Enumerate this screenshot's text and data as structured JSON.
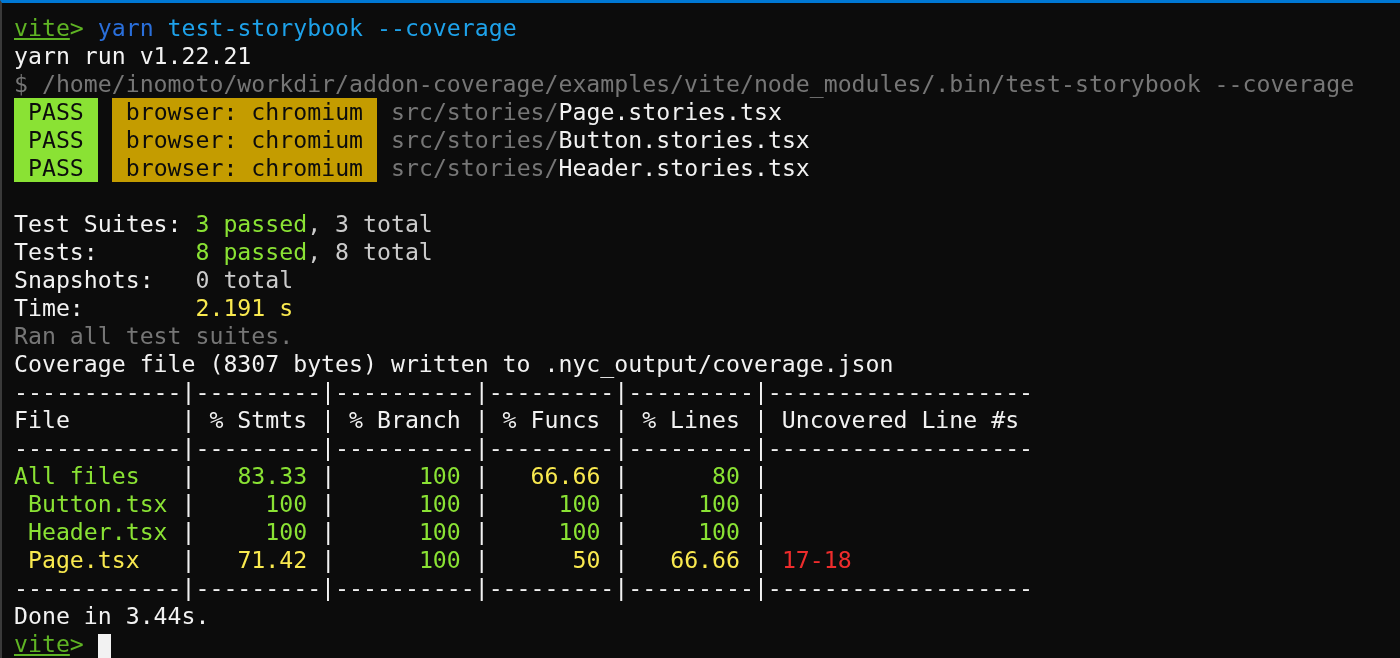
{
  "terminal": {
    "lines": [
      {
        "kind": "text",
        "segments": [
          {
            "text": "vite",
            "kind": "prompt_dir"
          },
          {
            "text": ">",
            "kind": "prompt_sign"
          },
          {
            "text": " yarn",
            "kind": "cmd_name"
          },
          {
            "text": " test-storybook --coverage",
            "kind": "cmd_arg"
          }
        ]
      },
      {
        "kind": "text",
        "segments": [
          {
            "text": "yarn run v1.22.21",
            "kind": "text"
          }
        ]
      },
      {
        "kind": "text",
        "segments": [
          {
            "text": "$ /home/inomoto/workdir/addon-coverage/examples/vite/node_modules/.bin/test-storybook --coverage",
            "kind": "muted"
          }
        ]
      },
      {
        "kind": "text",
        "segments": [
          {
            "text": " PASS ",
            "kind": "pass"
          },
          {
            "text": " browser: chromium ",
            "kind": "browser"
          },
          {
            "text": "src/stories/",
            "kind": "muted"
          },
          {
            "text": "Page.stories.tsx",
            "kind": "text"
          }
        ]
      },
      {
        "kind": "text",
        "segments": [
          {
            "text": " PASS ",
            "kind": "pass"
          },
          {
            "text": " browser: chromium ",
            "kind": "browser"
          },
          {
            "text": "src/stories/",
            "kind": "muted"
          },
          {
            "text": "Button.stories.tsx",
            "kind": "text"
          }
        ]
      },
      {
        "kind": "text",
        "segments": [
          {
            "text": " PASS ",
            "kind": "pass"
          },
          {
            "text": " browser: chromium ",
            "kind": "browser"
          },
          {
            "text": "src/stories/",
            "kind": "muted"
          },
          {
            "text": "Header.stories.tsx",
            "kind": "text"
          }
        ]
      },
      {
        "kind": "blank"
      },
      {
        "kind": "text",
        "segments": [
          {
            "text": "Test Suites: ",
            "kind": "text"
          },
          {
            "text": "3 passed",
            "kind": "ok"
          },
          {
            "text": ", 3 total",
            "kind": "soft"
          }
        ]
      },
      {
        "kind": "text",
        "segments": [
          {
            "text": "Tests:       ",
            "kind": "text"
          },
          {
            "text": "8 passed",
            "kind": "ok"
          },
          {
            "text": ", 8 total",
            "kind": "soft"
          }
        ]
      },
      {
        "kind": "text",
        "segments": [
          {
            "text": "Snapshots:   ",
            "kind": "text"
          },
          {
            "text": "0 total",
            "kind": "soft"
          }
        ]
      },
      {
        "kind": "text",
        "segments": [
          {
            "text": "Time:        ",
            "kind": "text"
          },
          {
            "text": "2.191 s",
            "kind": "warn"
          }
        ]
      },
      {
        "kind": "text",
        "segments": [
          {
            "text": "Ran all test suites.",
            "kind": "muted"
          }
        ]
      },
      {
        "kind": "text",
        "segments": [
          {
            "text": "Coverage file (8307 bytes) written to .nyc_output/coverage.json",
            "kind": "text"
          }
        ]
      },
      {
        "kind": "text",
        "segments": [
          {
            "text": "------------|---------|----------|---------|---------|-------------------",
            "kind": "text"
          }
        ]
      },
      {
        "kind": "text",
        "segments": [
          {
            "text": "File        | % Stmts | % Branch | % Funcs | % Lines | Uncovered Line #s",
            "kind": "text"
          }
        ]
      },
      {
        "kind": "text",
        "segments": [
          {
            "text": "------------|---------|----------|---------|---------|-------------------",
            "kind": "text"
          }
        ]
      },
      {
        "kind": "text",
        "segments": [
          {
            "text": "All files",
            "kind": "ok"
          },
          {
            "text": "   |   ",
            "kind": "text"
          },
          {
            "text": "83.33",
            "kind": "ok"
          },
          {
            "text": " |      ",
            "kind": "text"
          },
          {
            "text": "100",
            "kind": "ok"
          },
          {
            "text": " |   ",
            "kind": "text"
          },
          {
            "text": "66.66",
            "kind": "warn"
          },
          {
            "text": " |      ",
            "kind": "text"
          },
          {
            "text": "80",
            "kind": "ok"
          },
          {
            "text": " |",
            "kind": "text"
          }
        ]
      },
      {
        "kind": "text",
        "segments": [
          {
            "text": " Button.tsx",
            "kind": "ok"
          },
          {
            "text": " |     ",
            "kind": "text"
          },
          {
            "text": "100",
            "kind": "ok"
          },
          {
            "text": " |      ",
            "kind": "text"
          },
          {
            "text": "100",
            "kind": "ok"
          },
          {
            "text": " |     ",
            "kind": "text"
          },
          {
            "text": "100",
            "kind": "ok"
          },
          {
            "text": " |     ",
            "kind": "text"
          },
          {
            "text": "100",
            "kind": "ok"
          },
          {
            "text": " |",
            "kind": "text"
          }
        ]
      },
      {
        "kind": "text",
        "segments": [
          {
            "text": " Header.tsx",
            "kind": "ok"
          },
          {
            "text": " |     ",
            "kind": "text"
          },
          {
            "text": "100",
            "kind": "ok"
          },
          {
            "text": " |      ",
            "kind": "text"
          },
          {
            "text": "100",
            "kind": "ok"
          },
          {
            "text": " |     ",
            "kind": "text"
          },
          {
            "text": "100",
            "kind": "ok"
          },
          {
            "text": " |     ",
            "kind": "text"
          },
          {
            "text": "100",
            "kind": "ok"
          },
          {
            "text": " |",
            "kind": "text"
          }
        ]
      },
      {
        "kind": "text",
        "segments": [
          {
            "text": " Page.tsx",
            "kind": "warn"
          },
          {
            "text": "   |   ",
            "kind": "text"
          },
          {
            "text": "71.42",
            "kind": "warn"
          },
          {
            "text": " |      ",
            "kind": "text"
          },
          {
            "text": "100",
            "kind": "ok"
          },
          {
            "text": " |      ",
            "kind": "text"
          },
          {
            "text": "50",
            "kind": "warn"
          },
          {
            "text": " |   ",
            "kind": "text"
          },
          {
            "text": "66.66",
            "kind": "warn"
          },
          {
            "text": " | ",
            "kind": "text"
          },
          {
            "text": "17-18",
            "kind": "error"
          }
        ]
      },
      {
        "kind": "text",
        "segments": [
          {
            "text": "------------|---------|----------|---------|---------|-------------------",
            "kind": "text"
          }
        ]
      },
      {
        "kind": "text",
        "segments": [
          {
            "text": "Done in 3.44s.",
            "kind": "text"
          }
        ]
      },
      {
        "kind": "text",
        "cursor": true,
        "segments": [
          {
            "text": "vite",
            "kind": "prompt_dir"
          },
          {
            "text": ">",
            "kind": "prompt_sign"
          }
        ]
      }
    ]
  }
}
